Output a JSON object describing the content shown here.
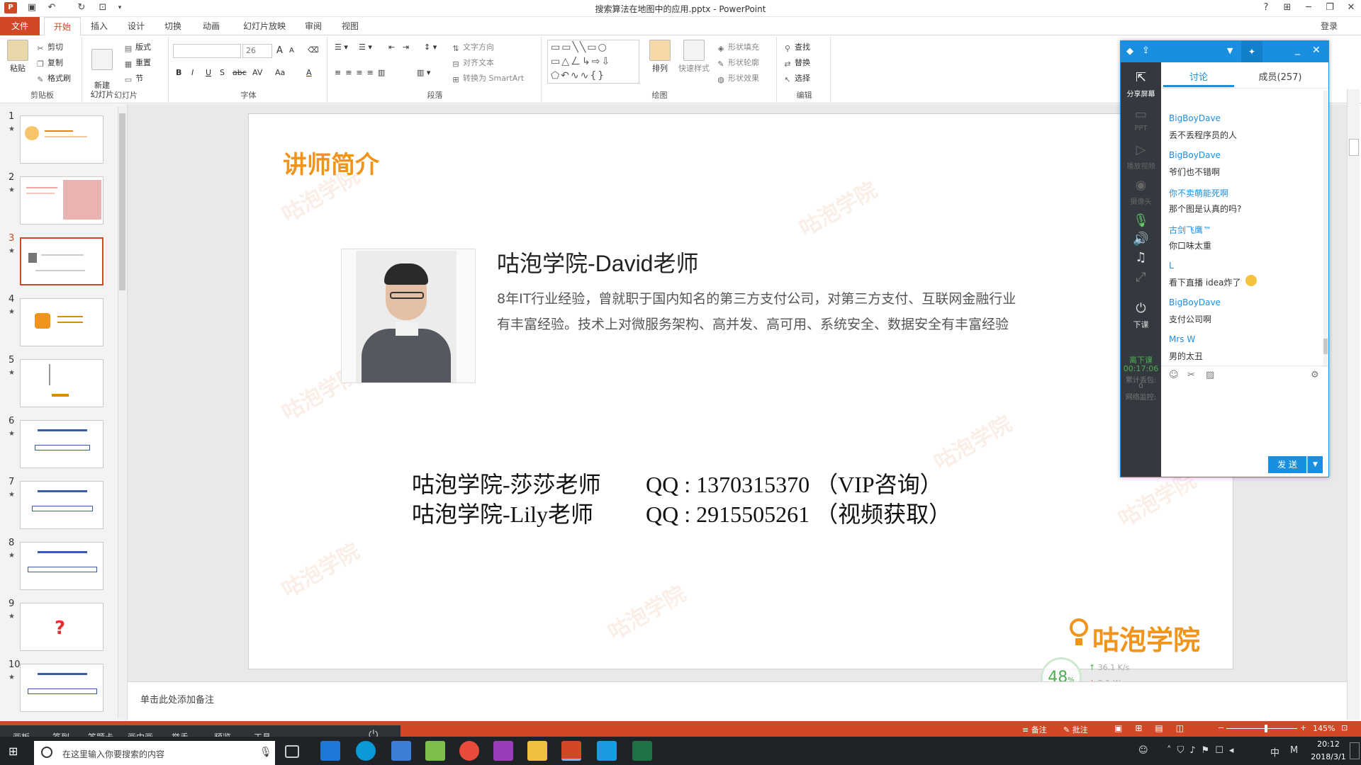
{
  "window": {
    "title": "搜索算法在地图中的应用.pptx - PowerPoint",
    "help": "?",
    "login": "登录"
  },
  "tabs": [
    {
      "label": "文件"
    },
    {
      "label": "开始"
    },
    {
      "label": "插入"
    },
    {
      "label": "设计"
    },
    {
      "label": "切换"
    },
    {
      "label": "动画"
    },
    {
      "label": "幻灯片放映"
    },
    {
      "label": "审阅"
    },
    {
      "label": "视图"
    }
  ],
  "ribbon": {
    "clipboard": {
      "paste": "粘贴",
      "cut": "剪切",
      "copy": "复制",
      "format_painter": "格式刷",
      "label": "剪贴板"
    },
    "slides": {
      "new_slide": "新建\n幻灯片",
      "layout": "版式",
      "reset": "重置",
      "section": "节",
      "label": "幻灯片"
    },
    "font": {
      "size": "26",
      "label": "字体",
      "bold": "B",
      "italic": "I",
      "underline": "U",
      "shadow": "S",
      "strike": "abc",
      "spacing": "AV",
      "case": "Aa",
      "color": "A",
      "grow": "A",
      "shrink": "A"
    },
    "paragraph": {
      "text_direction": "文字方向",
      "align_text": "对齐文本",
      "smartart": "转换为 SmartArt",
      "label": "段落"
    },
    "drawing": {
      "arrange": "排列",
      "quick_styles": "快速样式",
      "shape_fill": "形状填充",
      "shape_outline": "形状轮廓",
      "shape_effects": "形状效果",
      "label": "绘图"
    },
    "editing": {
      "find": "查找",
      "replace": "替换",
      "select": "选择",
      "label": "编辑"
    }
  },
  "thumbnails": [
    {
      "num": "1"
    },
    {
      "num": "2"
    },
    {
      "num": "3"
    },
    {
      "num": "4"
    },
    {
      "num": "5"
    },
    {
      "num": "6"
    },
    {
      "num": "7"
    },
    {
      "num": "8"
    },
    {
      "num": "9"
    },
    {
      "num": "10"
    }
  ],
  "slide": {
    "heading": "讲师简介",
    "teacher_name": "咕泡学院-David老师",
    "bio_line1": "8年IT行业经验，曾就职于国内知名的第三方支付公司，对第三方支付、互联网金融行业",
    "bio_line2": "有丰富经验。技术上对微服务架构、高并发、高可用、系统安全、数据安全有丰富经验",
    "contact1_name": "咕泡学院-莎莎老师",
    "contact1_qq": "QQ : 1370315370 （VIP咨询）",
    "contact2_name": "咕泡学院-Lily老师",
    "contact2_qq": "QQ : 2915505261 （视频获取）",
    "logo_text": "咕泡学院",
    "watermark": "咕泡学院"
  },
  "net_widget": {
    "percent": "48",
    "percent_unit": "%",
    "up": "36.1 K/s",
    "down": "2.1 K/s"
  },
  "notes": {
    "placeholder": "单击此处添加备注"
  },
  "statusbar": {
    "notes": "备注",
    "comments": "批注",
    "zoom": "145%"
  },
  "classbar": {
    "items": [
      "画板",
      "签到",
      "答题卡",
      "画中画",
      "举手",
      "预览",
      "工具"
    ]
  },
  "taskbar": {
    "search_placeholder": "在这里输入你要搜索的内容",
    "time": "20:12",
    "date": "2018/3/1",
    "ime": "中"
  },
  "panel": {
    "tabs": [
      "讨论",
      "成员(257)"
    ],
    "side": {
      "share": "分享屏幕",
      "ppt": "PPT",
      "video": "播放视频",
      "camera": "摄像头",
      "end_class": "下课",
      "timer_label": "离下课",
      "timer": "00:17:06",
      "packet_loss": "累计丢包:",
      "packet_value": "0",
      "net_monitor": "网络监控:"
    },
    "messages": [
      {
        "name": "BigBoyDave",
        "text": "丢不丢程序员的人"
      },
      {
        "name": "BigBoyDave",
        "text": "爷们也不错啊"
      },
      {
        "name": "你不卖萌能死啊",
        "text": "那个图是认真的吗?"
      },
      {
        "name": "古剑飞鹰™",
        "text": "你口味太重"
      },
      {
        "name": "L",
        "text": "看下直播 idea炸了"
      },
      {
        "name": "BigBoyDave",
        "text": "支付公司啊"
      },
      {
        "name": "Mrs W",
        "text": "男的太丑"
      }
    ],
    "send": "发 送"
  },
  "colors": {
    "accent": "#d24726",
    "orange": "#f0941b",
    "panel_blue": "#1a8fdf",
    "chat_name": "#1e8fe0"
  }
}
